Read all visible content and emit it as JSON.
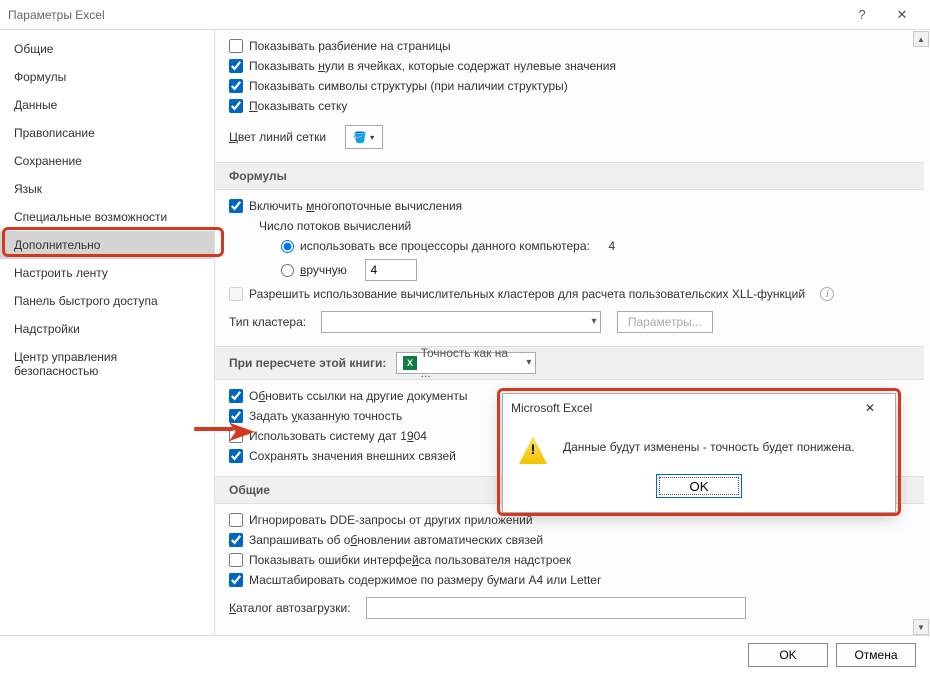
{
  "window": {
    "title": "Параметры Excel",
    "help": "?",
    "close": "✕"
  },
  "sidebar": {
    "items": [
      "Общие",
      "Формулы",
      "Данные",
      "Правописание",
      "Сохранение",
      "Язык",
      "Специальные возможности",
      "Дополнительно",
      "Настроить ленту",
      "Панель быстрого доступа",
      "Надстройки",
      "Центр управления безопасностью"
    ],
    "selected_index": 7
  },
  "display": {
    "show_page_breaks": "Показывать разбиение на страницы",
    "show_zero": "Показывать нули в ячейках, которые содержат нулевые значения",
    "show_outline": "Показывать символы структуры (при наличии структуры)",
    "show_grid": "Показывать сетку",
    "grid_color_label": "Цвет линий сетки"
  },
  "formulas": {
    "header": "Формулы",
    "multithread": "Включить многопоточные вычисления",
    "thread_num_label": "Число потоков вычислений",
    "use_all": "использовать все процессоры данного компьютера:",
    "proc_count": "4",
    "manual": "вручную",
    "manual_value": "4",
    "allow_xll": "Разрешить использование вычислительных кластеров для расчета пользовательских XLL-функций",
    "cluster_type_label": "Тип кластера:",
    "params_btn": "Параметры..."
  },
  "recalc": {
    "header": "При пересчете этой книги:",
    "book": "Точность как на ...",
    "update_links": "Обновить ссылки на другие документы",
    "set_precision": "Задать указанную точность",
    "date1904": "Использовать систему дат 1904",
    "save_ext": "Сохранять значения внешних связей"
  },
  "general": {
    "header": "Общие",
    "ignore_dde": "Игнорировать DDE-запросы от других приложений",
    "ask_links": "Запрашивать об обновлении автоматических связей",
    "addin_errors": "Показывать ошибки интерфейса пользователя надстроек",
    "scale_paper": "Масштабировать содержимое по размеру бумаги A4 или Letter",
    "autoload_label": "Каталог автозагрузки:"
  },
  "dialog": {
    "title": "Microsoft Excel",
    "message": "Данные будут изменены - точность будет понижена.",
    "ok": "OK"
  },
  "footer": {
    "ok": "OK",
    "cancel": "Отмена"
  }
}
